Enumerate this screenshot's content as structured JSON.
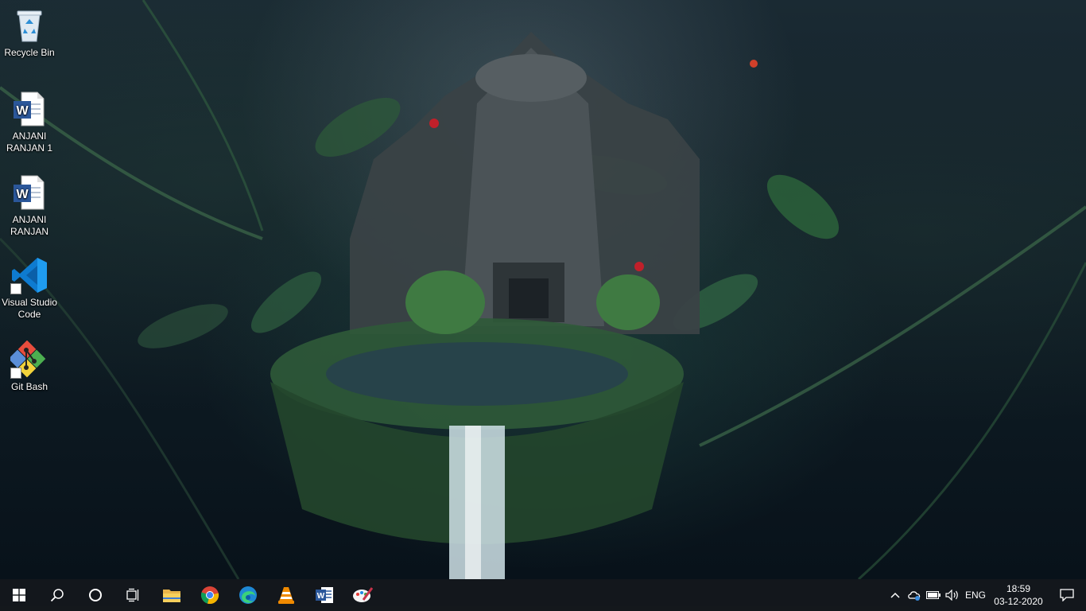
{
  "desktop": {
    "icons": [
      {
        "label": "Recycle Bin",
        "icon": "recycle-bin-icon"
      },
      {
        "label": "ANJANI RANJAN 1",
        "icon": "word-document-icon"
      },
      {
        "label": "ANJANI RANJAN",
        "icon": "word-document-icon"
      },
      {
        "label": "Visual Studio Code",
        "icon": "vscode-icon"
      },
      {
        "label": "Git Bash",
        "icon": "git-bash-icon"
      }
    ]
  },
  "taskbar": {
    "pinned": [
      {
        "name": "start",
        "icon": "windows-logo-icon"
      },
      {
        "name": "search",
        "icon": "search-icon"
      },
      {
        "name": "cortana",
        "icon": "cortana-circle-icon"
      },
      {
        "name": "task-view",
        "icon": "task-view-icon"
      },
      {
        "name": "file-explorer",
        "icon": "folder-icon"
      },
      {
        "name": "chrome",
        "icon": "chrome-icon"
      },
      {
        "name": "edge",
        "icon": "edge-icon"
      },
      {
        "name": "vlc",
        "icon": "vlc-icon"
      },
      {
        "name": "word",
        "icon": "word-icon"
      },
      {
        "name": "paint",
        "icon": "paint-icon"
      }
    ],
    "tray": {
      "language": "ENG",
      "time": "18:59",
      "date": "03-12-2020"
    }
  },
  "colors": {
    "taskbar_bg": "#14181c",
    "word_blue": "#2b579a",
    "vscode_blue": "#0e7bd0"
  }
}
